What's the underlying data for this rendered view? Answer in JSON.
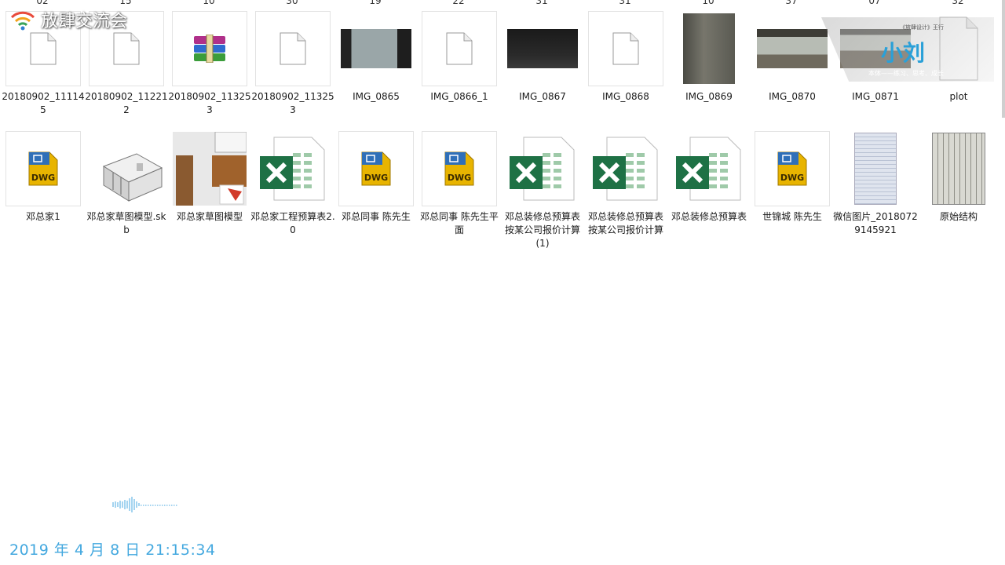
{
  "top_row_numbers": [
    "02",
    "15",
    "10",
    "30",
    "19",
    "22",
    "31",
    "31",
    "10",
    "37",
    "07",
    "32"
  ],
  "row1": [
    {
      "name": "20180902_111145",
      "type": "doc",
      "icon": "blank-file-icon"
    },
    {
      "name": "20180902_112212",
      "type": "doc",
      "icon": "blank-file-icon"
    },
    {
      "name": "20180902_113253",
      "type": "rar",
      "icon": "winrar-archive-icon"
    },
    {
      "name": "20180902_113253",
      "type": "doc",
      "icon": "blank-file-icon"
    },
    {
      "name": "IMG_0865",
      "type": "photo",
      "icon": "photo-thumbnail"
    },
    {
      "name": "IMG_0866_1",
      "type": "doc",
      "icon": "blank-file-icon"
    },
    {
      "name": "IMG_0867",
      "type": "photo",
      "icon": "photo-thumbnail"
    },
    {
      "name": "IMG_0868",
      "type": "doc",
      "icon": "blank-file-icon"
    },
    {
      "name": "IMG_0869",
      "type": "photo",
      "icon": "photo-thumbnail"
    },
    {
      "name": "IMG_0870",
      "type": "photo",
      "icon": "photo-thumbnail"
    },
    {
      "name": "IMG_0871",
      "type": "photo",
      "icon": "photo-thumbnail"
    },
    {
      "name": "plot",
      "type": "doc",
      "icon": "blank-file-icon"
    }
  ],
  "row2": [
    {
      "name": "邓总家1",
      "type": "dwg",
      "icon": "dwg-file-icon"
    },
    {
      "name": "邓总家草图模型.skb",
      "type": "model",
      "icon": "3d-model-thumbnail"
    },
    {
      "name": "邓总家草图模型",
      "type": "model",
      "icon": "sketchup-model-thumbnail"
    },
    {
      "name": "邓总家工程预算表2.0",
      "type": "xls",
      "icon": "excel-file-icon"
    },
    {
      "name": "邓总同事 陈先生",
      "type": "dwg",
      "icon": "dwg-file-icon"
    },
    {
      "name": "邓总同事 陈先生平面",
      "type": "dwg",
      "icon": "dwg-file-icon"
    },
    {
      "name": "邓总装修总预算表  按某公司报价计算(1)",
      "type": "xls",
      "icon": "excel-file-icon"
    },
    {
      "name": "邓总装修总预算表  按某公司报价计算",
      "type": "xls",
      "icon": "excel-file-icon"
    },
    {
      "name": "邓总装修总预算表",
      "type": "xls",
      "icon": "excel-file-icon"
    },
    {
      "name": "世锦城 陈先生",
      "type": "dwg",
      "icon": "dwg-file-icon"
    },
    {
      "name": "微信图片_20180729145921",
      "type": "photo",
      "icon": "scan-thumbnail"
    },
    {
      "name": "原始结构",
      "type": "photo",
      "icon": "floorplan-thumbnail"
    }
  ],
  "dwg_label": "DWG",
  "watermark_logo": "放肆交流会",
  "watermark_brand": {
    "big": "小刘",
    "small": "本体——练习、思考、成长",
    "tiny": "《放肆设计》王行"
  },
  "timestamp": "2019 年 4 月 8 日  21:15:34",
  "colors": {
    "timestamp": "#43a8df",
    "excel_green": "#1e7145",
    "dwg_yellow": "#e8b400",
    "dwg_blue": "#2f6fb8"
  }
}
